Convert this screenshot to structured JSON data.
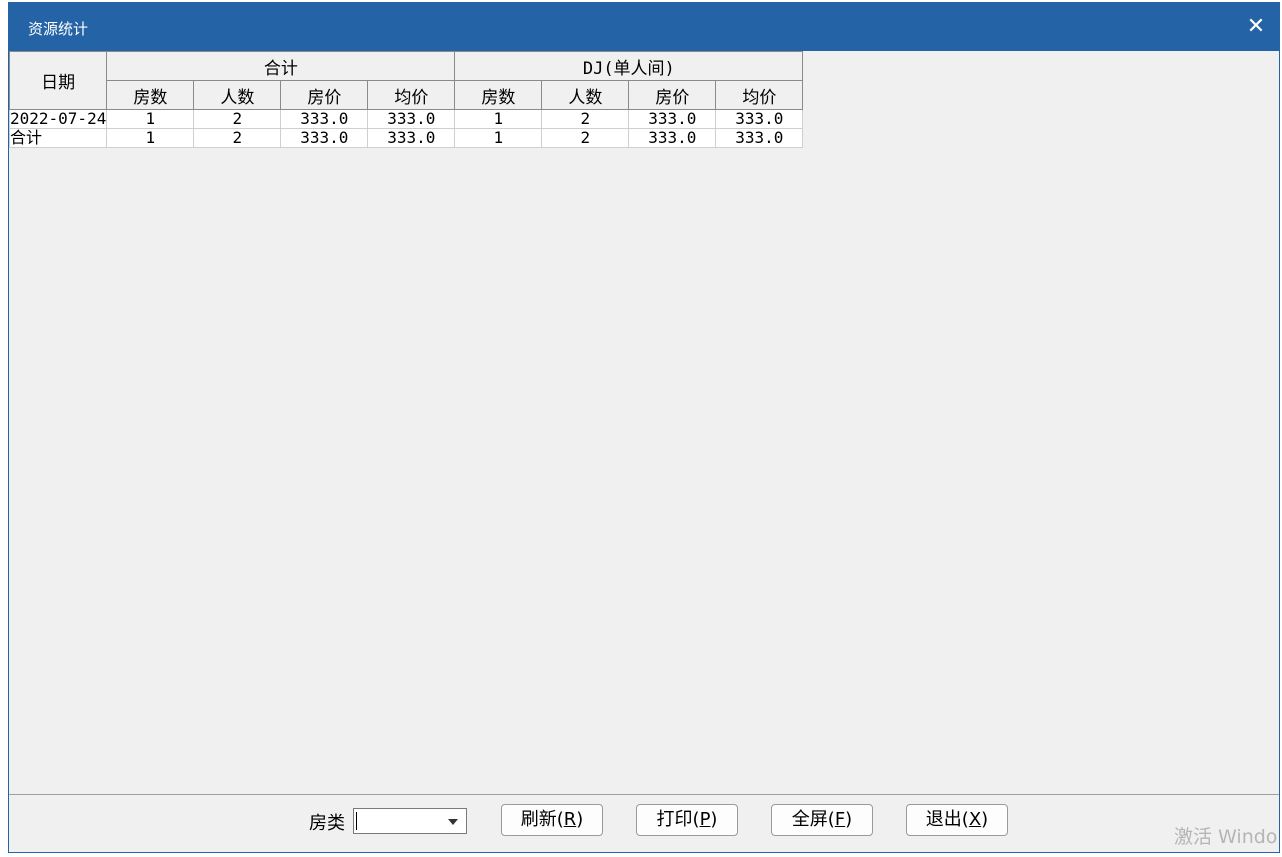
{
  "window": {
    "title": "资源统计",
    "close_glyph": "✕"
  },
  "table": {
    "row_header_label": "日期",
    "groups": [
      "合计",
      "DJ(单人间)"
    ],
    "subcolumns": [
      "房数",
      "人数",
      "房价",
      "均价"
    ],
    "rows": [
      {
        "label": "2022-07-24",
        "values": [
          "1",
          "2",
          "333.0",
          "333.0",
          "1",
          "2",
          "333.0",
          "333.0"
        ]
      },
      {
        "label": "合计",
        "values": [
          "1",
          "2",
          "333.0",
          "333.0",
          "1",
          "2",
          "333.0",
          "333.0"
        ]
      }
    ]
  },
  "footer": {
    "room_type_label": "房类",
    "room_type_value": "",
    "buttons": [
      {
        "text": "刷新",
        "key": "R"
      },
      {
        "text": "打印",
        "key": "P"
      },
      {
        "text": "全屏",
        "key": "F"
      },
      {
        "text": "退出",
        "key": "X"
      }
    ]
  },
  "watermark": "激活 Windo"
}
